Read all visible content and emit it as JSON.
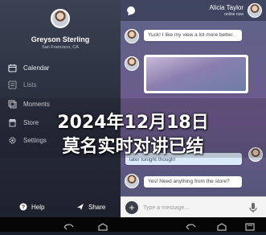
{
  "drawer": {
    "profile": {
      "name": "Greyson Sterling",
      "location": "San Francisco, CA"
    },
    "menu": [
      {
        "label": "Calendar",
        "icon": "calendar-icon"
      },
      {
        "label": "Lists",
        "icon": "list-icon"
      },
      {
        "label": "Moments",
        "icon": "moments-icon"
      },
      {
        "label": "Store",
        "icon": "store-icon"
      },
      {
        "label": "Settings",
        "icon": "gear-icon"
      }
    ],
    "footer": {
      "help": "Help",
      "share": "Share"
    }
  },
  "chat": {
    "contact": {
      "name": "Alicia Taylor",
      "status": "online now"
    },
    "messages": [
      {
        "from": "contact",
        "text": "Yuck! I like my view a lot more better."
      },
      {
        "from": "contact",
        "text": ""
      },
      {
        "from": "me",
        "text": "later tonight though!"
      },
      {
        "from": "contact",
        "text": "Yes! Need anything from the store?"
      }
    ],
    "composer": {
      "placeholder": "Type a message..."
    }
  },
  "overlay": {
    "line1": "2024年12月18日",
    "line2": "莫名实时对讲已结"
  },
  "colors": {
    "accent": "#3b3f4a",
    "bubble_mine": "#dbeafb"
  }
}
